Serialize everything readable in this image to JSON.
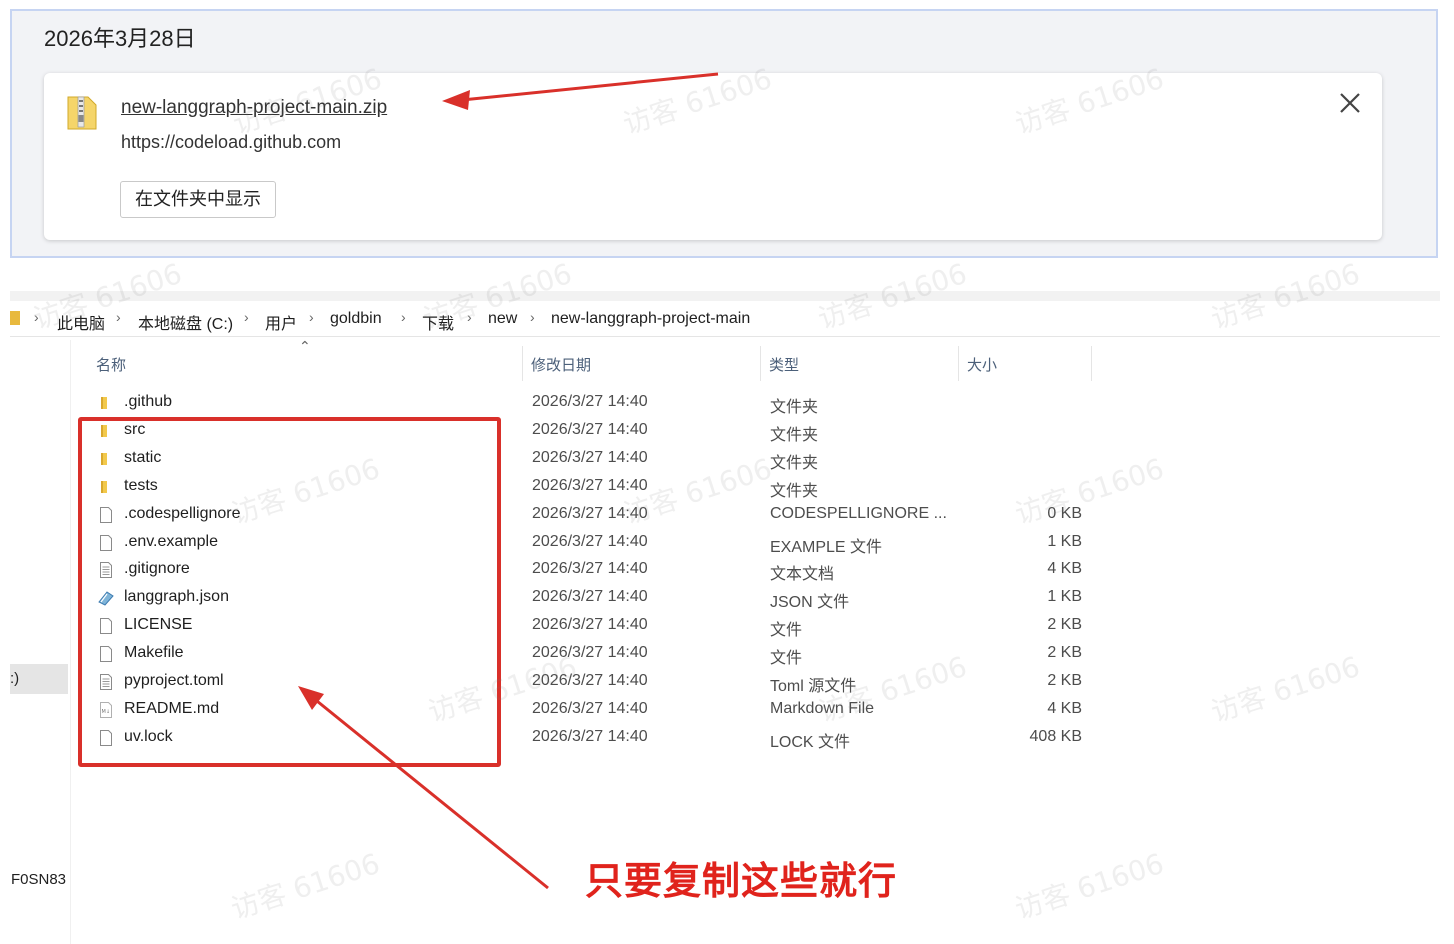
{
  "download": {
    "date_header": "2026年3月28日",
    "filename": "new-langgraph-project-main.zip",
    "source_url": "https://codeload.github.com",
    "show_in_folder_label": "在文件夹中显示"
  },
  "breadcrumb": [
    "此电脑",
    "本地磁盘 (C:)",
    "用户",
    "goldbin",
    "下载",
    "new",
    "new-langgraph-project-main"
  ],
  "nav_pane": {
    "selected_label": ":)",
    "bottom_label": "F0SN83"
  },
  "columns": {
    "name": "名称",
    "date": "修改日期",
    "type": "类型",
    "size": "大小"
  },
  "files": [
    {
      "name": ".github",
      "date": "2026/3/27 14:40",
      "type": "文件夹",
      "size": "",
      "icon": "folder-icon"
    },
    {
      "name": "src",
      "date": "2026/3/27 14:40",
      "type": "文件夹",
      "size": "",
      "icon": "folder-icon"
    },
    {
      "name": "static",
      "date": "2026/3/27 14:40",
      "type": "文件夹",
      "size": "",
      "icon": "folder-icon"
    },
    {
      "name": "tests",
      "date": "2026/3/27 14:40",
      "type": "文件夹",
      "size": "",
      "icon": "folder-icon"
    },
    {
      "name": ".codespellignore",
      "date": "2026/3/27 14:40",
      "type": "CODESPELLIGNORE ...",
      "size": "0 KB",
      "icon": "file-icon"
    },
    {
      "name": ".env.example",
      "date": "2026/3/27 14:40",
      "type": "EXAMPLE 文件",
      "size": "1 KB",
      "icon": "file-icon"
    },
    {
      "name": ".gitignore",
      "date": "2026/3/27 14:40",
      "type": "文本文档",
      "size": "4 KB",
      "icon": "text-file-icon"
    },
    {
      "name": "langgraph.json",
      "date": "2026/3/27 14:40",
      "type": "JSON 文件",
      "size": "1 KB",
      "icon": "json-file-icon"
    },
    {
      "name": "LICENSE",
      "date": "2026/3/27 14:40",
      "type": "文件",
      "size": "2 KB",
      "icon": "file-icon"
    },
    {
      "name": "Makefile",
      "date": "2026/3/27 14:40",
      "type": "文件",
      "size": "2 KB",
      "icon": "file-icon"
    },
    {
      "name": "pyproject.toml",
      "date": "2026/3/27 14:40",
      "type": "Toml 源文件",
      "size": "2 KB",
      "icon": "text-file-icon"
    },
    {
      "name": "README.md",
      "date": "2026/3/27 14:40",
      "type": "Markdown File",
      "size": "4 KB",
      "icon": "markdown-file-icon"
    },
    {
      "name": "uv.lock",
      "date": "2026/3/27 14:40",
      "type": "LOCK 文件",
      "size": "408 KB",
      "icon": "file-icon"
    }
  ],
  "annotation": {
    "caption": "只要复制这些就行",
    "color": "#e0231c"
  },
  "watermark": "访客 61606"
}
